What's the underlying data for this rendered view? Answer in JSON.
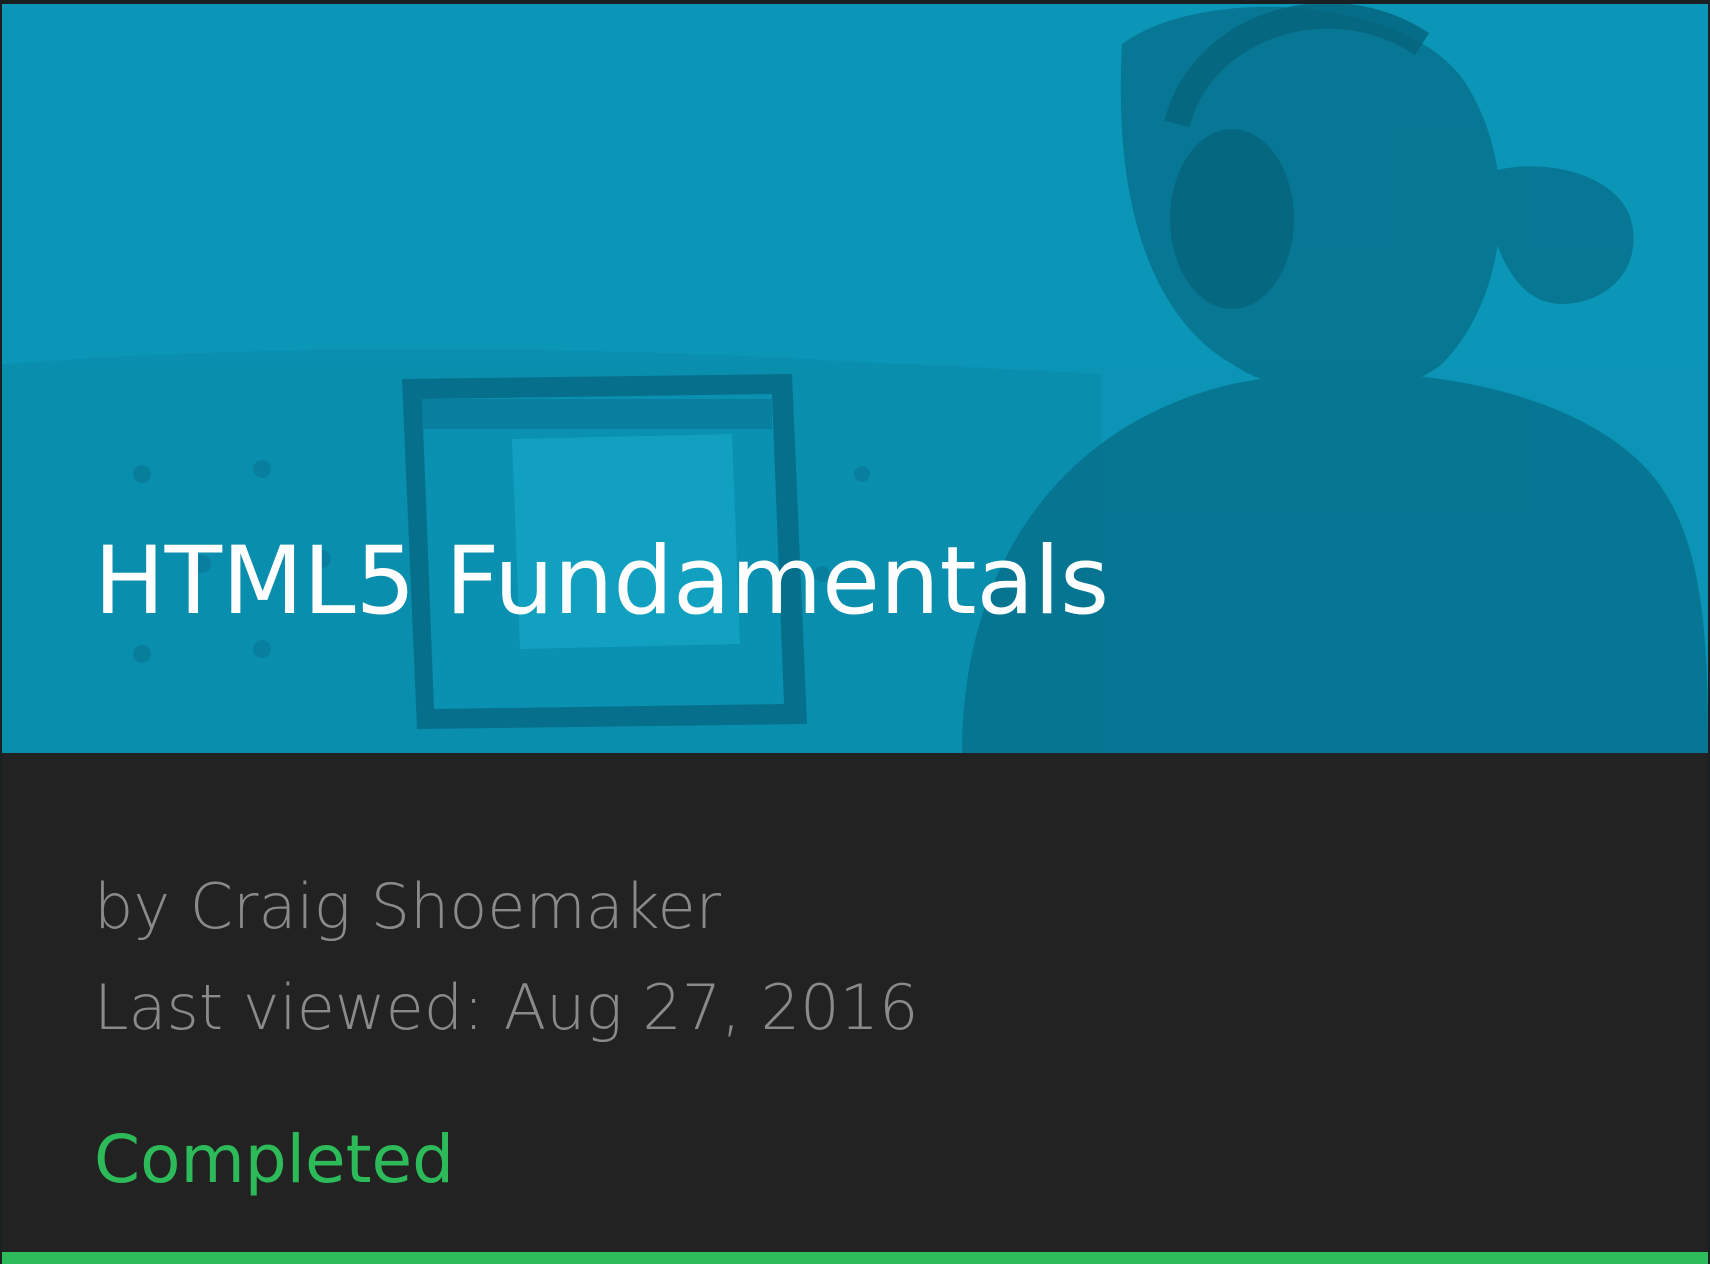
{
  "course": {
    "title": "HTML5 Fundamentals",
    "author": "by Craig Shoemaker",
    "last_viewed": "Last viewed: Aug 27, 2016",
    "status": "Completed",
    "progress_fraction": 1.0
  },
  "colors": {
    "hero_tint": "#0b91b2",
    "card_background": "#222222",
    "meta_text": "#8a8a8a",
    "status_text": "#2dbb5a",
    "progress_bar": "#2ebb5c"
  }
}
